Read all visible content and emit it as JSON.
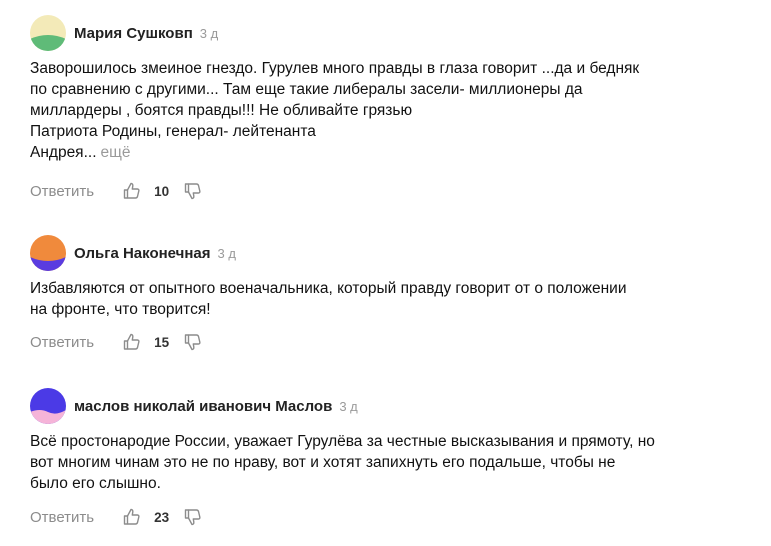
{
  "comments": [
    {
      "author": "Мария Сушковп",
      "time": "3 д",
      "lines": [
        "Заворошилось змеиное гнездо. Гурулев много правды в глаза говорит ...да и бедняк",
        "по сравнению с другими... Там еще такие либералы засели- миллионеры да",
        "миллардеры , боятся правды!!! Не обливайте грязью",
        "Патриота Родины, генерал- лейтенанта",
        "Андрея..."
      ],
      "more_label": "ещё",
      "reply_label": "Ответить",
      "likes": "10",
      "avatar_colors": {
        "top": "#f3eab8",
        "bottom": "#5fbb78"
      }
    },
    {
      "author": "Ольга Наконечная",
      "time": "3 д",
      "lines": [
        "Избавляются от опытного военачальника, который правду говорит от о положении",
        "на фронте, что творится!"
      ],
      "reply_label": "Ответить",
      "likes": "15",
      "avatar_colors": {
        "top": "#f08a3c",
        "bottom": "#5a3ce0"
      }
    },
    {
      "author": "маслов николай иванович Маслов",
      "time": "3 д",
      "lines": [
        "Всё простонародие России, уважает Гурулёва за честные высказывания и прямоту, но",
        "вот многим чинам это не по нраву, вот и хотят запихнуть его подальше, чтобы не",
        "было его слышно."
      ],
      "reply_label": "Ответить",
      "likes": "23",
      "avatar_colors": {
        "top": "#4b3ae6",
        "bottom": "#f5b4d8"
      }
    }
  ]
}
